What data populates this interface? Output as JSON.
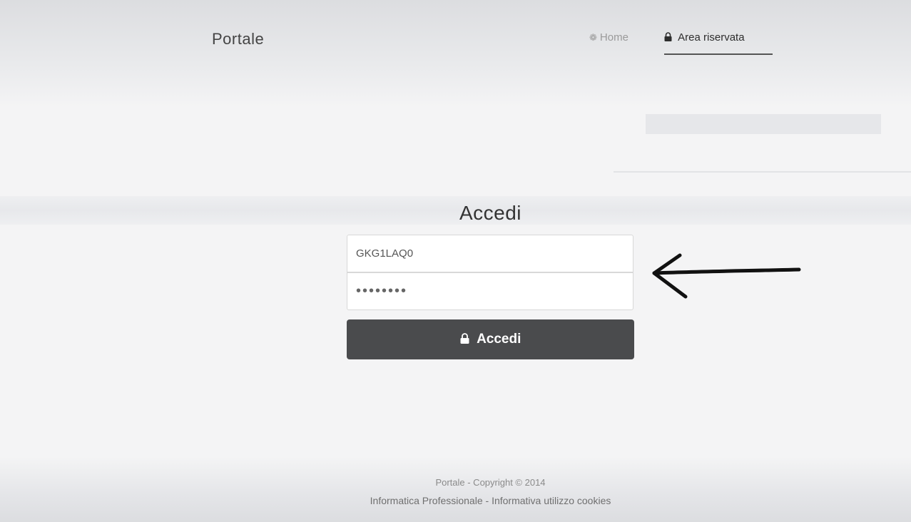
{
  "navbar": {
    "brand": "Portale",
    "home": {
      "icon": "home-icon",
      "label": "Home"
    },
    "reserved": {
      "icon": "lock-icon",
      "label": "Area riservata"
    }
  },
  "login": {
    "title": "Accedi",
    "username_value": "GKG1LAQ0",
    "password_value": "••••••••",
    "submit": {
      "icon": "lock-icon",
      "label": "Accedi"
    }
  },
  "annotation": {
    "icon": "arrow-left-icon",
    "color": "#111111"
  },
  "footer": {
    "copyright": "Portale - Copyright © 2014",
    "company": "Informatica Professionale",
    "separator": " - ",
    "cookies": "Informativa utilizzo cookies"
  },
  "colors": {
    "button_bg": "#4a4b4d",
    "text_dark": "#333333",
    "nav_muted": "#9a9a9a"
  }
}
